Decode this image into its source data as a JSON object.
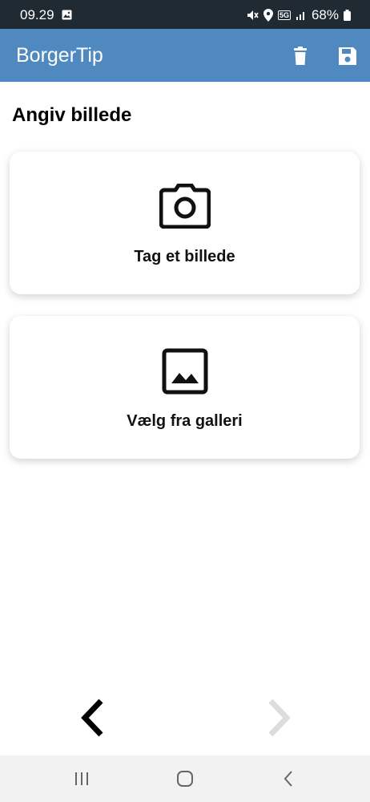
{
  "status_bar": {
    "time": "09.29",
    "battery": "68%",
    "network": "5G"
  },
  "app_bar": {
    "title": "BorgerTip",
    "icons": [
      "trash-icon",
      "save-icon"
    ]
  },
  "page": {
    "title": "Angiv billede"
  },
  "cards": {
    "take_photo": {
      "label": "Tag et billede",
      "icon": "camera-icon"
    },
    "gallery": {
      "label": "Vælg fra galleri",
      "icon": "image-icon"
    }
  },
  "nav": {
    "prev_icon": "chevron-left-icon",
    "next_icon": "chevron-right-icon"
  },
  "colors": {
    "app_bar": "#5089bf",
    "status_bar": "#1f2a33",
    "next_disabled": "#dddddd"
  }
}
